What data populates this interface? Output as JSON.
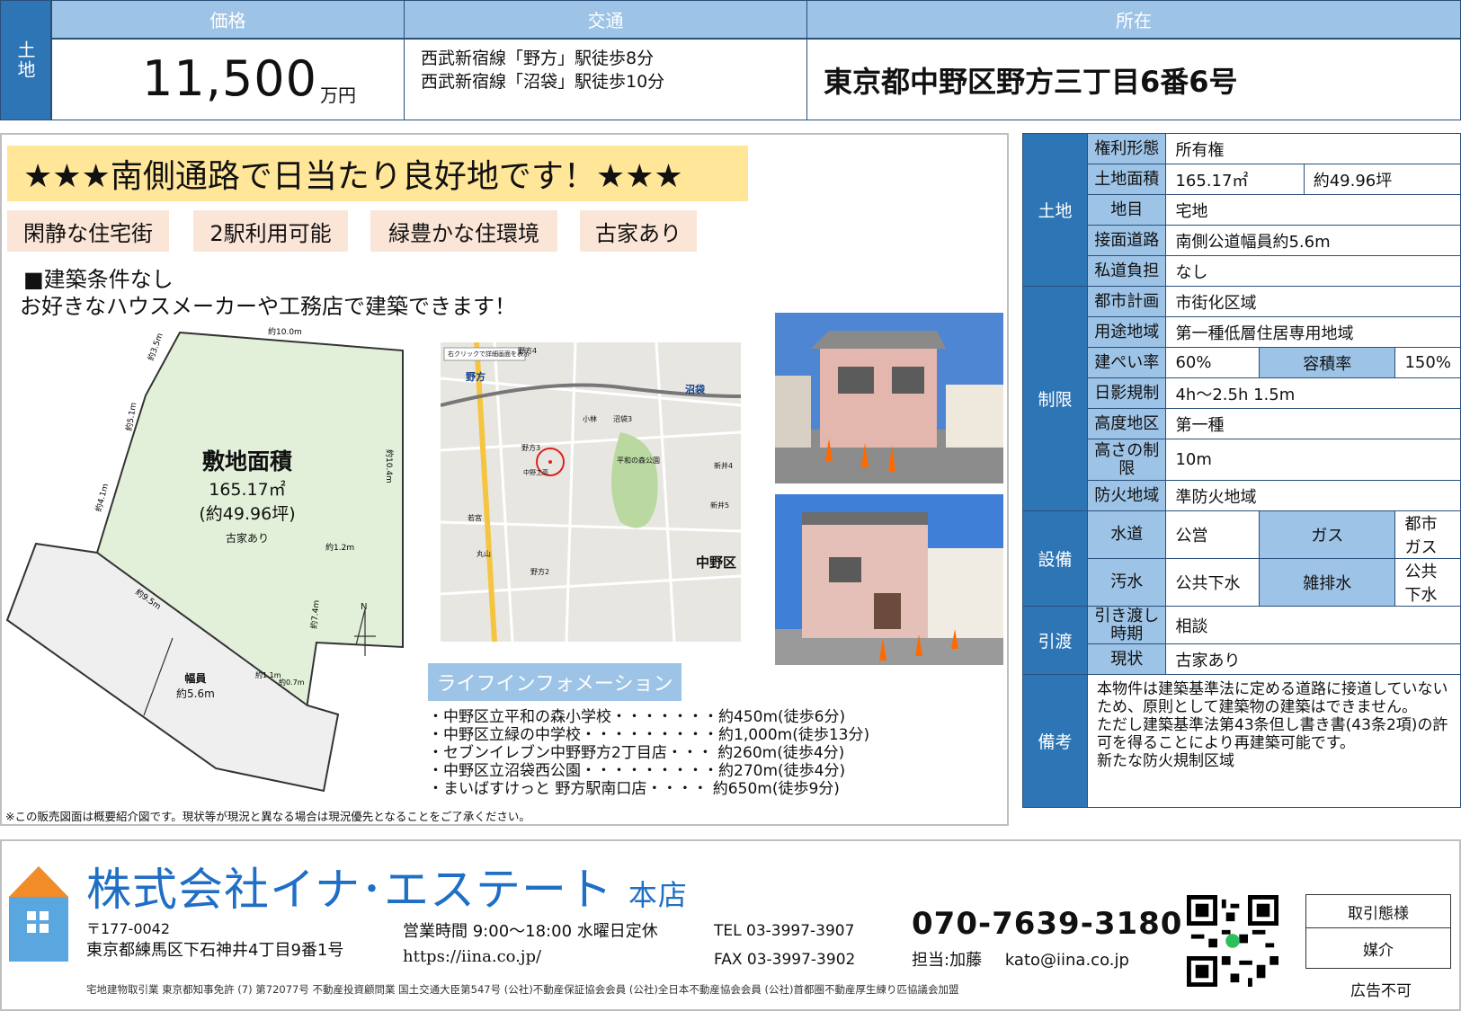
{
  "header": {
    "category": "土地",
    "price_label": "価格",
    "price_value": "11,500",
    "price_unit": "万円",
    "access_label": "交通",
    "access_lines": [
      "西武新宿線「野方」駅徒歩8分",
      "西武新宿線「沼袋」駅徒歩10分"
    ],
    "location_label": "所在",
    "location_value": "東京都中野区野方三丁目6番6号"
  },
  "main": {
    "headline": "★★★南側通路で日当たり良好地です！★★★",
    "tags": [
      "閑静な住宅街",
      "2駅利用可能",
      "緑豊かな住環境",
      "古家あり"
    ],
    "condition_lines": [
      "■建築条件なし",
      "お好きなハウスメーカーや工務店で建築できます！"
    ],
    "plan": {
      "title": "敷地面積",
      "area_m2": "165.17㎡",
      "area_tsubo": "(約49.96坪)",
      "note": "古家あり",
      "road_title": "幅員",
      "road_width": "約5.6m",
      "north": "N",
      "dims": [
        "約10.0m",
        "約3.5m",
        "約5.1m",
        "約10.4m",
        "約4.1m",
        "約1.2m",
        "約7.4m",
        "約9.5m",
        "約1.1m",
        "約0.7m"
      ]
    },
    "map": {
      "labels": [
        "野方",
        "沼袋",
        "中野区",
        "野方4",
        "沼袋3",
        "野方3",
        "新井4",
        "新井5",
        "小林",
        "野方2",
        "若宮",
        "平和の森公園",
        "丸山",
        "中野工高"
      ],
      "caption": "右クリックで詳細画面を表示"
    },
    "life_title": "ライフインフォメーション",
    "life_items": [
      "・中野区立平和の森小学校・・・・・・・約450m(徒歩6分)",
      "・中野区立緑の中学校・・・・・・・・・約1,000m(徒歩13分)",
      "・セブンイレブン中野野方2丁目店・・・ 約260m(徒歩4分)",
      "・中野区立沼袋西公園・・・・・・・・・約270m(徒歩4分)",
      "・まいばすけっと 野方駅南口店・・・・  約650m(徒歩9分)"
    ],
    "footnote": "※この販売図面は概要紹介図です。現状等が現況と異なる場合は現況優先となることをご了承ください。"
  },
  "spec": {
    "land": {
      "category": "土地",
      "rows": [
        {
          "label": "権利形態",
          "value": "所有権"
        },
        {
          "label": "土地面積",
          "value": "165.17㎡",
          "value2": "約49.96坪"
        },
        {
          "label": "地目",
          "value": "宅地"
        },
        {
          "label": "接面道路",
          "value": "南側公道幅員約5.6m"
        },
        {
          "label": "私道負担",
          "value": "なし"
        }
      ]
    },
    "restrict": {
      "category": "制限",
      "rows": [
        {
          "label": "都市計画",
          "value": "市街化区域"
        },
        {
          "label": "用途地域",
          "value": "第一種低層住居専用地域"
        },
        {
          "label": "建ぺい率",
          "value": "60%",
          "label2": "容積率",
          "value2": "150%"
        },
        {
          "label": "日影規制",
          "value": "4h～2.5h 1.5m"
        },
        {
          "label": "高度地区",
          "value": "第一種"
        },
        {
          "label": "高さの制限",
          "value": "10m"
        },
        {
          "label": "防火地域",
          "value": "準防火地域"
        }
      ]
    },
    "facility": {
      "category": "設備",
      "rows": [
        {
          "label": "水道",
          "value": "公営",
          "label2": "ガス",
          "value2": "都市ガス"
        },
        {
          "label": "汚水",
          "value": "公共下水",
          "label2": "雑排水",
          "value2": "公共下水"
        }
      ]
    },
    "handover": {
      "category": "引渡",
      "rows": [
        {
          "label": "引き渡し時期",
          "value": "相談"
        },
        {
          "label": "現状",
          "value": "古家あり"
        }
      ]
    },
    "remarks": {
      "category": "備考",
      "text": [
        "本物件は建築基準法に定める道路に接道していないため、原則として建築物の建築はできません。",
        "ただし建築基準法第43条但し書き書(43条2項)の許可を得ることにより再建築可能です。",
        "新たな防火規制区域"
      ]
    }
  },
  "footer": {
    "company": "株式会社イナ･エステート",
    "branch": "本店",
    "postal": "〒177-0042",
    "address": "東京都練馬区下石神井4丁目9番1号",
    "hours": "営業時間 9:00～18:00  水曜日定休",
    "url": "https://iina.co.jp/",
    "tel": "TEL   03-3997-3907",
    "fax": "FAX   03-3997-3902",
    "mobile": "070-7639-3180",
    "staff": "担当:加藤",
    "email": "kato@iina.co.jp",
    "license": "宅地建物取引業 東京都知事免許 (7) 第72077号    不動産投資顧問業 国土交通大臣第547号  (公社)不動産保証協会会員  (公社)全日本不動産協会会員  (公社)首都圏不動産厚生練り匹協議会加盟",
    "deal_label": "取引態様",
    "deal_value": "媒介",
    "ad_note": "広告不可"
  },
  "colors": {
    "header_blue": "#2e75b6",
    "light_blue": "#9dc3e6",
    "headline_yellow": "#ffe699",
    "tag_peach": "#fbe5d6",
    "company_blue": "#1f6fc5",
    "plan_green": "#e2f0d9"
  }
}
